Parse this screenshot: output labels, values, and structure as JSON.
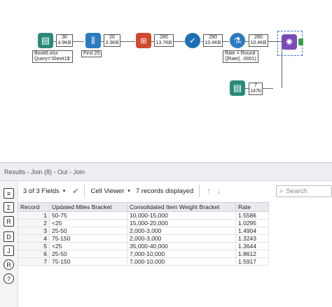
{
  "workflow": {
    "tools": [
      {
        "name": "input-tool",
        "icon": "book-icon",
        "color": "#2a8a7a"
      },
      {
        "name": "select-tool",
        "icon": "columns-icon",
        "color": "#2b7bbf"
      },
      {
        "name": "formula-tool",
        "icon": "formula-icon",
        "color": "#d04a2f"
      },
      {
        "name": "check-tool",
        "icon": "check-icon",
        "color": "#1d6fb5"
      },
      {
        "name": "flask-tool",
        "icon": "flask-icon",
        "color": "#2b7bbf"
      },
      {
        "name": "join-tool",
        "icon": "join-icon",
        "color": "#7a4bb5"
      },
      {
        "name": "input2-tool",
        "icon": "book-icon",
        "color": "#2a8a7a"
      }
    ],
    "badges": [
      {
        "top": "30",
        "bottom": "4.9KB"
      },
      {
        "top": "20",
        "bottom": "3.3KB"
      },
      {
        "top": "280",
        "bottom": "13.7KB"
      },
      {
        "top": "280",
        "bottom": "10.4KB"
      },
      {
        "top": "280",
        "bottom": "10.4KB"
      },
      {
        "top": "7",
        "bottom": "147b"
      }
    ],
    "annotations": {
      "input": "Book6.xlsx\nQuery='Sheet1$'",
      "select": "First 20",
      "formula": "Rate = Round\n([Rate], .0001)"
    }
  },
  "results_title": "Results - Join (8) - Out - Join",
  "toolbar": {
    "fields_label": "3 of 3 Fields",
    "viewer_label": "Cell Viewer",
    "records_label": "7 records displayed",
    "search_placeholder": "Search"
  },
  "table": {
    "headers": [
      "Record",
      "Updated Miles Bracket",
      "Consolidated Item Weight Bracket",
      "Rate"
    ],
    "rows": [
      [
        "1",
        "50-75",
        "10,000-15,000",
        "1.5586"
      ],
      [
        "2",
        "<25",
        "15,000-20,000",
        "1.0295"
      ],
      [
        "3",
        "25-50",
        "2,000-3,000",
        "1.4904"
      ],
      [
        "4",
        "75-150",
        "2,000-3,000",
        "1.3243"
      ],
      [
        "5",
        "<25",
        "35,000-40,000",
        "1.3644"
      ],
      [
        "6",
        "25-50",
        "7,000-10,000",
        "1.8612"
      ],
      [
        "7",
        "75-150",
        "7,000-10,000",
        "1.5917"
      ]
    ]
  }
}
